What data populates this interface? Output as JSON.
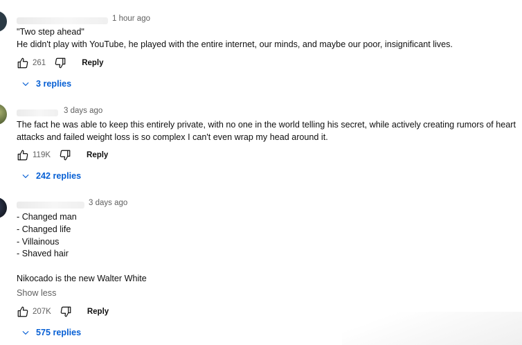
{
  "comments": [
    {
      "time": "1 hour ago",
      "lines": [
        "\"Two step ahead\"",
        "He didn't play with YouTube, he played with the entire internet, our minds, and maybe our poor, insignificant lives."
      ],
      "likes": "261",
      "reply_label": "Reply",
      "replies_label": "3 replies",
      "avatar_color": "#2b3a45"
    },
    {
      "time": "3 days ago",
      "lines": [
        "The fact he was able to keep this entirely private, with no one in the world telling  his secret, while actively creating rumors of heart",
        "attacks and failed weight loss is so complex I can't even wrap my head around it."
      ],
      "likes": "119K",
      "reply_label": "Reply",
      "replies_label": "242 replies",
      "avatar_color": "#6a7a4a"
    },
    {
      "time": "3 days ago",
      "lines": [
        "- Changed man",
        "- Changed life",
        "- Villainous",
        "- Shaved hair",
        "",
        "Nikocado is the new Walter White"
      ],
      "show_less": "Show less",
      "likes": "207K",
      "reply_label": "Reply",
      "replies_label": "575 replies",
      "avatar_color": "#1d2230"
    }
  ],
  "colors": {
    "link": "#065fd4",
    "secondary": "#606060",
    "text": "#0f0f0f"
  },
  "icons": {
    "like": "thumb-up-icon",
    "dislike": "thumb-down-icon",
    "expand": "chevron-down-icon"
  }
}
